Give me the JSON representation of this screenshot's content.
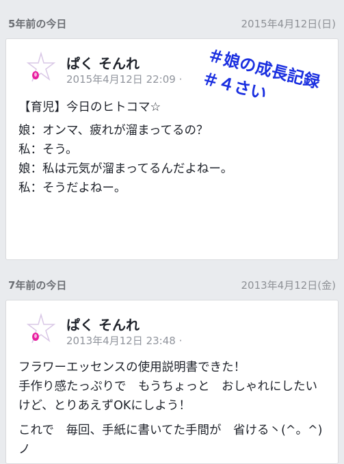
{
  "posts": [
    {
      "section_title": "5年前の今日",
      "section_date": "2015年4月12日(日)",
      "author": "ぱく そんれ",
      "timestamp": "2015年4月12日 22:09 ·",
      "overlay_line1": "＃娘の成長記録",
      "overlay_line2": "＃４さい",
      "lines": [
        "【育児】今日のヒトコマ☆",
        "娘：オンマ、疲れが溜まってるの？",
        "私：そう。",
        "娘：私は元気が溜まってるんだよねー。",
        "私：そうだよねー。"
      ]
    },
    {
      "section_title": "7年前の今日",
      "section_date": "2013年4月12日(金)",
      "author": "ぱく そんれ",
      "timestamp": "2013年4月12日 23:48 ·",
      "lines": [
        "フラワーエッセンスの使用説明書できた！",
        "手作り感たっぷりで　もうちょっと　おしゃれにしたいけど、とりあえずOKにしよう！",
        "これで　毎回、手紙に書いてた手間が　省ける丶(^。^)ノ"
      ]
    }
  ]
}
